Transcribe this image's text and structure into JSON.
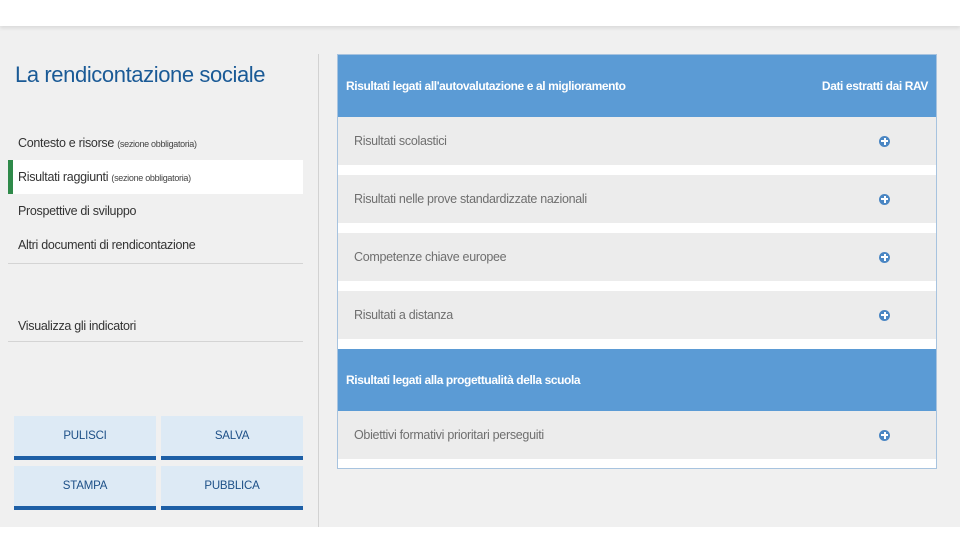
{
  "page": {
    "title": "La rendicontazione sociale"
  },
  "sidebar": {
    "items": [
      {
        "label": "Contesto e risorse",
        "note": "(sezione obbligatoria)"
      },
      {
        "label": "Risultati raggiunti",
        "note": "(sezione obbligatoria)",
        "active": true
      },
      {
        "label": "Prospettive di sviluppo",
        "note": ""
      },
      {
        "label": "Altri documenti di rendicontazione",
        "note": ""
      }
    ],
    "indicators_link": "Visualizza gli indicatori"
  },
  "actions": {
    "clear_label": "PULISCI",
    "save_label": "SALVA",
    "print_label": "STAMPA",
    "publish_label": "PUBBLICA"
  },
  "results": {
    "section1": {
      "title": "Risultati legati all'autovalutazione e al miglioramento",
      "right_label": "Dati estratti dai RAV",
      "rows": [
        "Risultati scolastici",
        "Risultati nelle prove standardizzate nazionali",
        "Competenze chiave europee",
        "Risultati a distanza"
      ]
    },
    "section2": {
      "title": "Risultati legati alla progettualità della scuola",
      "rows": [
        "Obiettivi formativi prioritari perseguiti"
      ]
    }
  },
  "colors": {
    "accent": "#1a5a96",
    "header_blue": "#5b9bd5",
    "button_border": "#1d5fa6",
    "active_marker": "#2f8a4a",
    "expand_icon": "#4a86c3"
  },
  "icons": {
    "expand": "plus-circle-icon"
  }
}
